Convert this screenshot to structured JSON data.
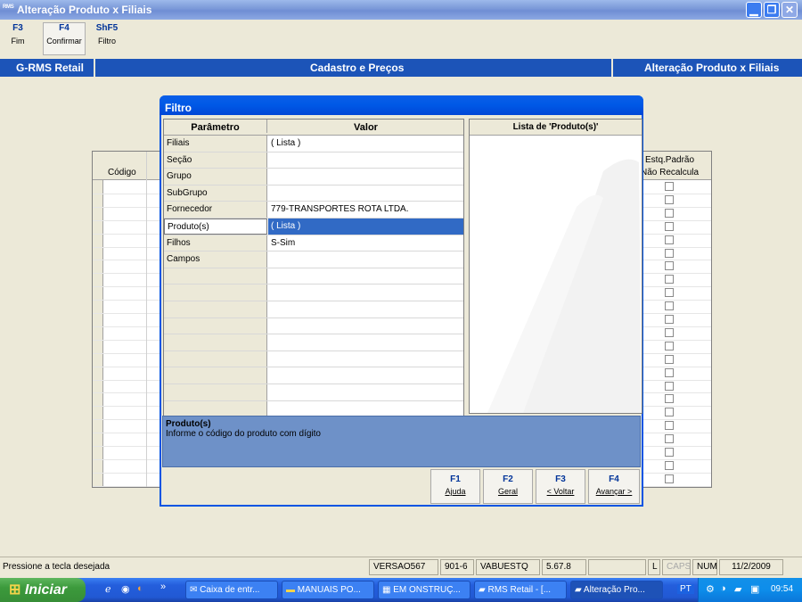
{
  "window": {
    "app_icon": "RMS",
    "title": "Alteração Produto x Filiais"
  },
  "fkeys": [
    {
      "key": "F3",
      "label": "Fim"
    },
    {
      "key": "F4",
      "label": "Confirmar"
    },
    {
      "key": "ShF5",
      "label": "Filtro"
    }
  ],
  "header": {
    "left": "G-RMS Retail",
    "center": "Cadastro e Preços",
    "right": "Alteração Produto x Filiais"
  },
  "bg_grid": {
    "col_codigo": "Código",
    "col_estq_top": "Estq.Padrão",
    "col_estq_bottom": "Não Recalcula"
  },
  "dialog": {
    "title": "Filtro",
    "col_param": "Parâmetro",
    "col_valor": "Valor",
    "list_title": "Lista de 'Produto(s)'",
    "rows": [
      {
        "param": "Filiais",
        "valor": "( Lista )"
      },
      {
        "param": "Seção",
        "valor": ""
      },
      {
        "param": "Grupo",
        "valor": ""
      },
      {
        "param": "SubGrupo",
        "valor": ""
      },
      {
        "param": "Fornecedor",
        "valor": "779-TRANSPORTES ROTA LTDA."
      },
      {
        "param": "Produto(s)",
        "valor": "( Lista )"
      },
      {
        "param": "Filhos",
        "valor": "S-Sim"
      },
      {
        "param": "Campos",
        "valor": ""
      }
    ],
    "hint_title": "Produto(s)",
    "hint_text": "Informe o código do produto com dígito",
    "buttons": [
      {
        "key": "F1",
        "label": "Ajuda"
      },
      {
        "key": "F2",
        "label": "Geral"
      },
      {
        "key": "F3",
        "label": "< Voltar"
      },
      {
        "key": "F4",
        "label": "Avançar >"
      }
    ]
  },
  "status": {
    "message": "Pressione a tecla desejada",
    "version": "VERSAO567",
    "code1": "901-6",
    "code2": "VABUESTQ",
    "code3": "5.67.8",
    "l": "L",
    "caps": "CAPS",
    "num": "NUM",
    "date": "11/2/2009"
  },
  "taskbar": {
    "start": "Iniciar",
    "tasks": [
      "Caixa de entr...",
      "MANUAIS PO...",
      "EM ONSTRUÇ...",
      "RMS Retail - [...",
      "Alteração Pro..."
    ],
    "lang": "PT",
    "clock": "09:54"
  },
  "colors": {
    "accent_blue": "#1C54B8",
    "selection": "#316AC5",
    "hint_bg": "#6E91C8",
    "fkey_blue": "#003399"
  }
}
